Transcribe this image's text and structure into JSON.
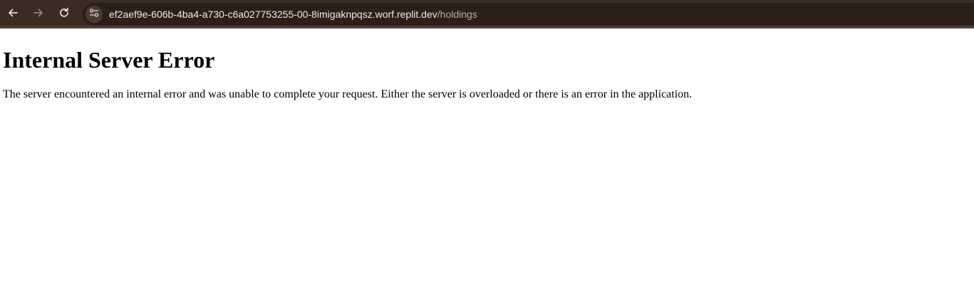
{
  "browser": {
    "url_host": "ef2aef9e-606b-4ba4-a730-c6a027753255-00-8imigaknpqsz.worf.replit.dev",
    "url_path": "/holdings",
    "icons": [
      "back-arrow-icon",
      "forward-arrow-icon",
      "reload-icon",
      "site-settings-icon"
    ],
    "colors": {
      "toolbar": "#3a2c22",
      "omnibox": "#2b1f18",
      "url_text": "#f1ebe6",
      "url_path_text": "#b8ada6"
    }
  },
  "page": {
    "heading": "Internal Server Error",
    "message": "The server encountered an internal error and was unable to complete your request. Either the server is overloaded or there is an error in the application."
  }
}
